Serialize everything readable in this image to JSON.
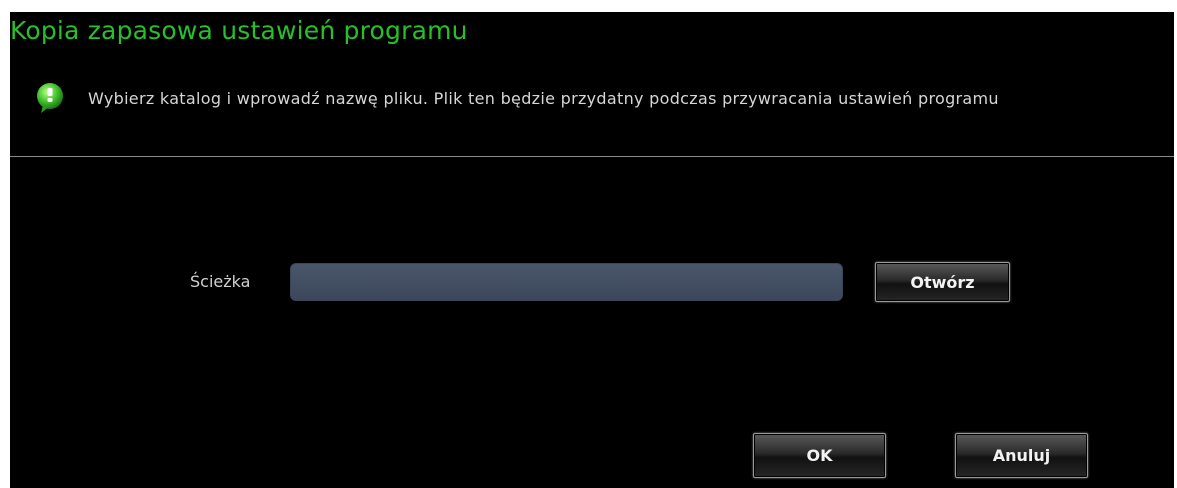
{
  "dialog": {
    "title": "Kopia zapasowa ustawień programu",
    "info_text": "Wybierz katalog i wprowadź nazwę pliku. Plik ten będzie przydatny podczas przywracania ustawień programu",
    "info_icon": "info-bubble-icon",
    "title_color": "#27c02b"
  },
  "form": {
    "path_label": "Ścieżka",
    "path_value": "",
    "open_button": "Otwórz"
  },
  "footer": {
    "ok_button": "OK",
    "cancel_button": "Anuluj"
  }
}
